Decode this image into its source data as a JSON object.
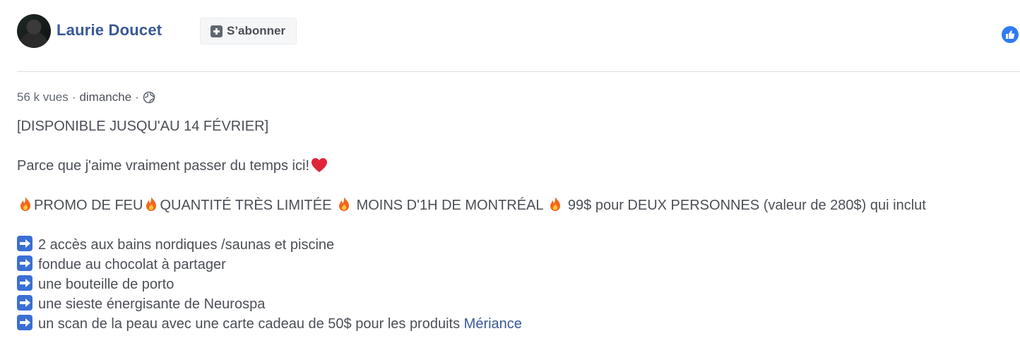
{
  "post": {
    "author": "Laurie Doucet",
    "subscribe_label": "S’abonner",
    "views": "56 k vues",
    "sep1": "·",
    "date": "dimanche",
    "sep2": "·",
    "lines": {
      "headline": "[DISPONIBLE JUSQU'AU 14 FÉVRIER]",
      "intro": "Parce que j'aime vraiment passer du temps ici!",
      "promo_1": "PROMO DE FEU",
      "promo_2": "QUANTITÉ TRÈS LIMITÉE ",
      "promo_3": " MOINS D'1H DE MONTRÉAL ",
      "promo_4": " 99$ pour DEUX PERSONNES (valeur de 280$) qui inclut"
    },
    "items": [
      "2 accès aux bains nordiques /saunas et piscine",
      "fondue au chocolat à partager",
      "une bouteille de porto",
      "une sieste énergisante de Neurospa",
      "un scan de la peau avec une carte cadeau de 50$ pour les produits "
    ],
    "link_text": "Mériance",
    "icons": {
      "avatar": "avatar-photo",
      "subscribe": "plus-square-icon",
      "like": "like-icon",
      "globe": "globe-icon",
      "fire": "fire-emoji",
      "heart": "heart-emoji",
      "arrow": "right-arrow-emoji"
    },
    "colors": {
      "author": "#385898",
      "link": "#385898",
      "like": "#2f7bf5"
    }
  }
}
